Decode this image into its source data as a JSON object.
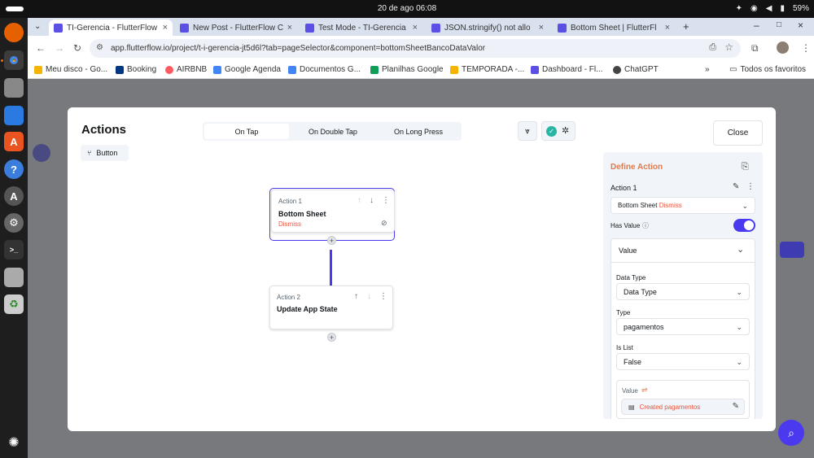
{
  "os": {
    "clock": "20 de ago  06:08",
    "battery": "59%"
  },
  "browser": {
    "tabs": [
      {
        "title": "TI-Gerencia - FlutterFlow",
        "active": true
      },
      {
        "title": "New Post - FlutterFlow C",
        "active": false
      },
      {
        "title": "Test Mode - TI-Gerencia",
        "active": false
      },
      {
        "title": "JSON.stringify() not allo",
        "active": false
      },
      {
        "title": "Bottom Sheet | FlutterFl",
        "active": false
      }
    ],
    "url": "app.flutterflow.io/project/t-i-gerencia-jt5d6l?tab=pageSelector&component=bottomSheetBancoDataValor",
    "bookmarks": [
      {
        "label": "Meu disco - Go...",
        "color": "#f4b400"
      },
      {
        "label": "Booking",
        "color": "#003580"
      },
      {
        "label": "AIRBNB",
        "color": "#ff5a5f"
      },
      {
        "label": "Google Agenda",
        "color": "#4285f4"
      },
      {
        "label": "Documentos G...",
        "color": "#4285f4"
      },
      {
        "label": "Planilhas Google",
        "color": "#0f9d58"
      },
      {
        "label": "TEMPORADA -...",
        "color": "#f4b400"
      },
      {
        "label": "Dashboard - Fl...",
        "color": "#5b4fe6"
      },
      {
        "label": "ChatGPT",
        "color": "#444444"
      }
    ],
    "bookmarks_more": "»",
    "all_bookmarks": "Todos os favoritos"
  },
  "modal": {
    "title": "Actions",
    "widget_chip": "Button",
    "triggers": [
      {
        "label": "On Tap",
        "active": true
      },
      {
        "label": "On Double Tap",
        "active": false
      },
      {
        "label": "On Long Press",
        "active": false
      }
    ],
    "close_label": "Close",
    "actions": [
      {
        "index_label": "Action 1",
        "name": "Bottom Sheet",
        "sub": "Dismiss",
        "selected": true
      },
      {
        "index_label": "Action 2",
        "name": "Update App State",
        "sub": "",
        "selected": false
      }
    ]
  },
  "panel": {
    "title": "Define Action",
    "action_label": "Action 1",
    "action_type": "Bottom Sheet",
    "action_subtype": "Dismiss",
    "has_value_label": "Has Value",
    "has_value": true,
    "value_section": "Value",
    "data_type_label": "Data Type",
    "data_type_value": "Data Type",
    "type_label": "Type",
    "type_value": "pagamentos",
    "is_list_label": "Is List",
    "is_list_value": "False",
    "value_label": "Value",
    "value_source": "Created pagamentos"
  },
  "colors": {
    "accent": "#4b39ef",
    "warning": "#e8563f",
    "panel_header": "#e07a4a"
  }
}
